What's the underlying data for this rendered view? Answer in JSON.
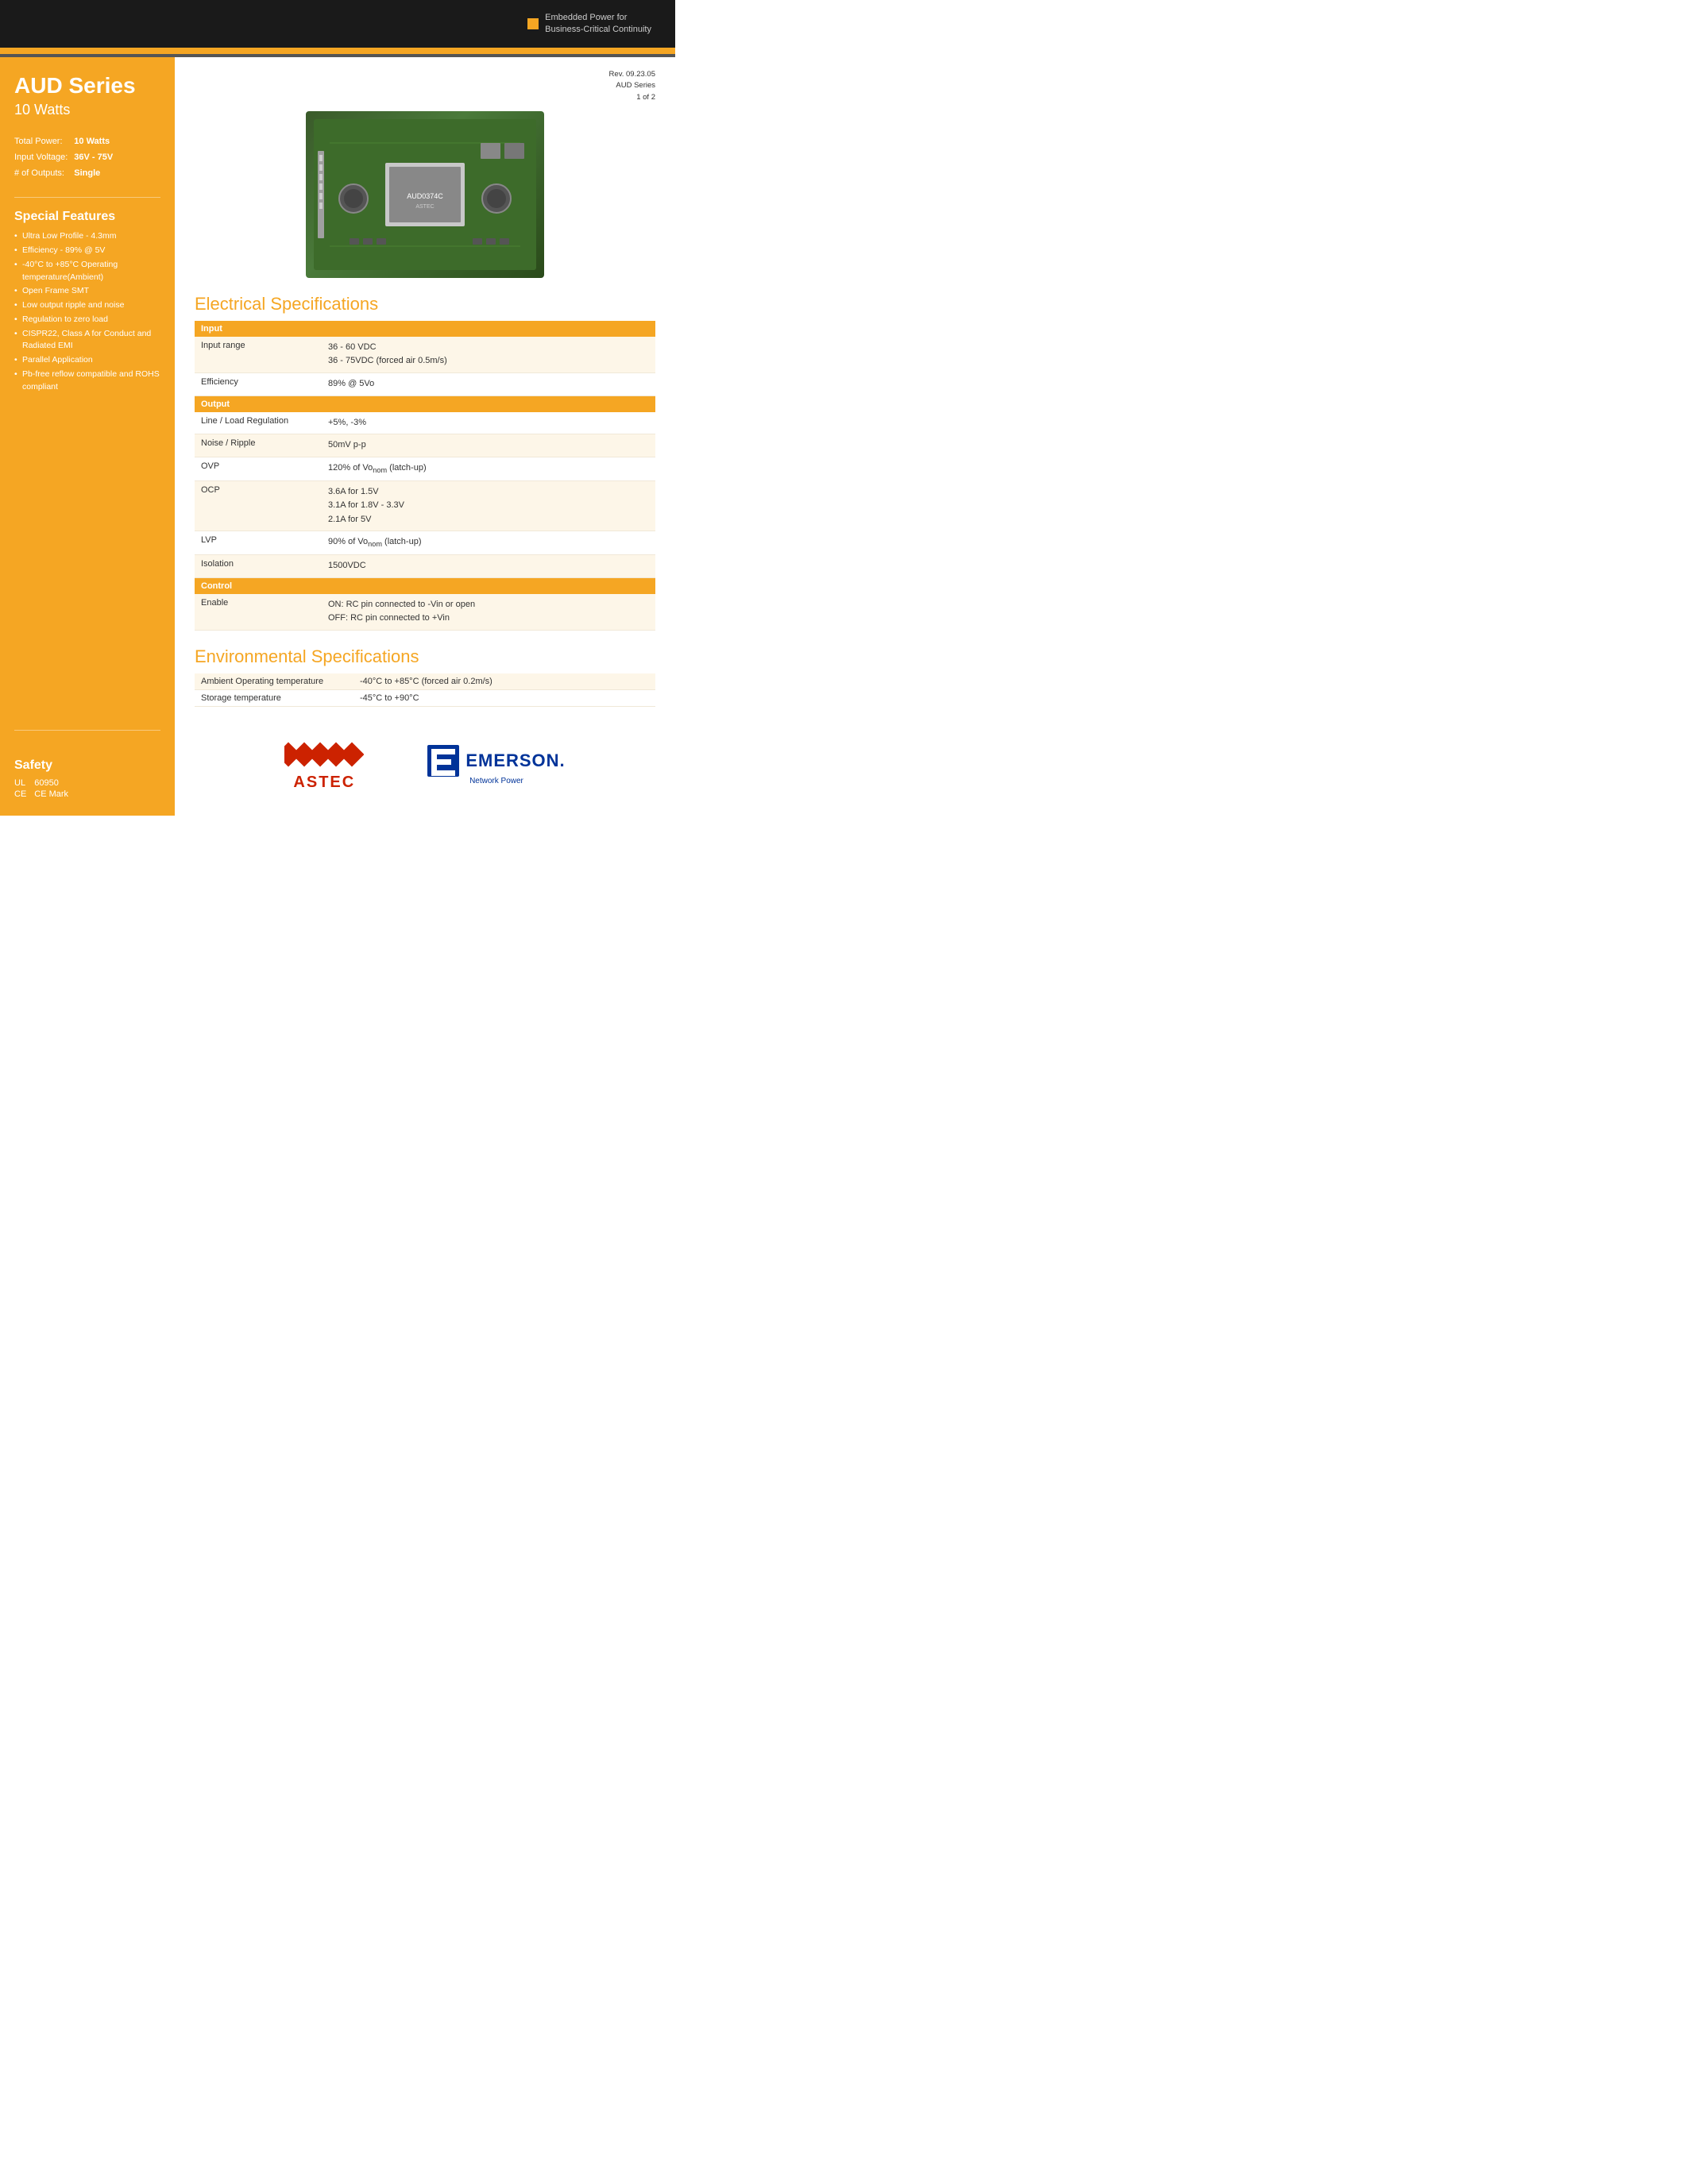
{
  "header": {
    "badge_text_line1": "Embedded Power for",
    "badge_text_line2": "Business-Critical Continuity"
  },
  "rev_info": {
    "line1": "Rev. 09.23.05",
    "line2": "AUD Series",
    "line3": "1 of 2"
  },
  "sidebar": {
    "title": "AUD Series",
    "subtitle": "10 Watts",
    "specs": [
      {
        "label": "Total Power:",
        "value": "10 Watts"
      },
      {
        "label": "Input Voltage:",
        "value": "36V - 75V"
      },
      {
        "label": "# of Outputs:",
        "value": "Single"
      }
    ],
    "special_features_title": "Special Features",
    "features": [
      "Ultra Low Profile - 4.3mm",
      "Efficiency - 89% @ 5V",
      "-40°C to +85°C Operating temperature(Ambient)",
      "Open Frame SMT",
      "Low output ripple and noise",
      "Regulation to zero load",
      "CISPR22, Class A for Conduct and Radiated EMI",
      "Parallel Application",
      "Pb-free reflow compatible and ROHS compliant"
    ],
    "safety_title": "Safety",
    "safety_items": [
      {
        "label": "UL",
        "value": "60950"
      },
      {
        "label": "CE",
        "value": "CE Mark"
      }
    ]
  },
  "electrical_title": "Electrical Specifications",
  "sections": [
    {
      "header": "Input",
      "rows": [
        {
          "label": "Input range",
          "value_lines": [
            "36 - 60 VDC",
            "36 - 75VDC (forced air 0.5m/s)"
          ]
        },
        {
          "label": "Efficiency",
          "value_lines": [
            "89% @ 5Vo"
          ]
        }
      ]
    },
    {
      "header": "Output",
      "rows": [
        {
          "label": "Line / Load Regulation",
          "value_lines": [
            "+5%, -3%"
          ]
        },
        {
          "label": "Noise / Ripple",
          "value_lines": [
            "50mV p-p"
          ]
        },
        {
          "label": "OVP",
          "value_lines": [
            "120% of Vonom (latch-up)"
          ]
        },
        {
          "label": "OCP",
          "value_lines": [
            "3.6A for 1.5V",
            "3.1A for 1.8V - 3.3V",
            "2.1A for 5V"
          ]
        },
        {
          "label": "LVP",
          "value_lines": [
            "90% of Vonom (latch-up)"
          ]
        },
        {
          "label": "Isolation",
          "value_lines": [
            "1500VDC"
          ]
        }
      ]
    },
    {
      "header": "Control",
      "rows": [
        {
          "label": "Enable",
          "value_lines": [
            "ON: RC pin connected to -Vin or open",
            "OFF: RC pin connected to +Vin"
          ]
        }
      ]
    }
  ],
  "environmental_title": "Environmental Specifications",
  "env_rows": [
    {
      "label": "Ambient Operating temperature",
      "value": "-40°C to +85°C (forced air 0.2m/s)"
    },
    {
      "label": "Storage temperature",
      "value": "-45°C to +90°C"
    }
  ],
  "logos": {
    "astec_text": "ASTEC",
    "emerson_text": "EMERSON.",
    "emerson_sub": "Network Power"
  }
}
